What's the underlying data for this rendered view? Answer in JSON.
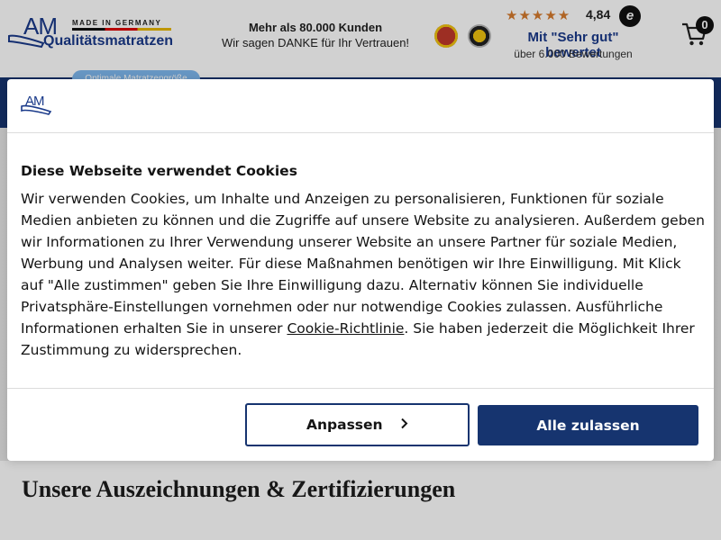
{
  "header": {
    "logo_am": "AM",
    "logo_tagline": "MADE IN GERMANY",
    "logo_name": "Qualitätsmatratzen",
    "customers_line1": "Mehr als 80.000 Kunden",
    "customers_line2": "Wir sagen DANKE für Ihr Vertrauen!",
    "rating_stars": "★★★★★",
    "rating_score": "4,84",
    "rating_label": "Mit \"Sehr gut\" bewertet",
    "rating_sub": "über 6.000 Bewertungen",
    "cart_count": "0",
    "pill_label": "Optimale Matratzengröße finden"
  },
  "page": {
    "awards_title": "Unsere Auszeichnungen & Zertifizierungen"
  },
  "cookie_dialog": {
    "logo_am": "AM",
    "title": "Diese Webseite verwendet Cookies",
    "body_before_link": "Wir verwenden Cookies, um Inhalte und Anzeigen zu personalisieren, Funktionen für soziale Medien anbieten zu können und die Zugriffe auf unsere Website zu analysieren. Außerdem geben wir Informationen zu Ihrer Verwendung unserer Website an unsere Partner für soziale Medien, Werbung und Analysen weiter. Für diese Maßnahmen benötigen wir Ihre Einwilligung. Mit Klick auf \"Alle zustimmen\" geben Sie Ihre Einwilligung dazu. Alternativ können Sie individuelle Privatsphäre-Einstellungen vornehmen oder nur notwendige Cookies zulassen. Ausführliche Informationen erhalten Sie in unserer ",
    "link_label": "Cookie-Richtlinie",
    "body_after_link": ". Sie haben jederzeit die Möglichkeit Ihrer Zustimmung zu widersprechen.",
    "customize_label": "Anpassen",
    "accept_label": "Alle zulassen"
  },
  "colors": {
    "brand_navy": "#16346f",
    "brand_blue": "#1a3a8a",
    "star_orange": "#d67a2c"
  },
  "icons": [
    "ehi-seal-icon",
    "trusted-shops-seal-icon",
    "trusted-e-icon",
    "cart-icon",
    "chevron-right-icon"
  ]
}
